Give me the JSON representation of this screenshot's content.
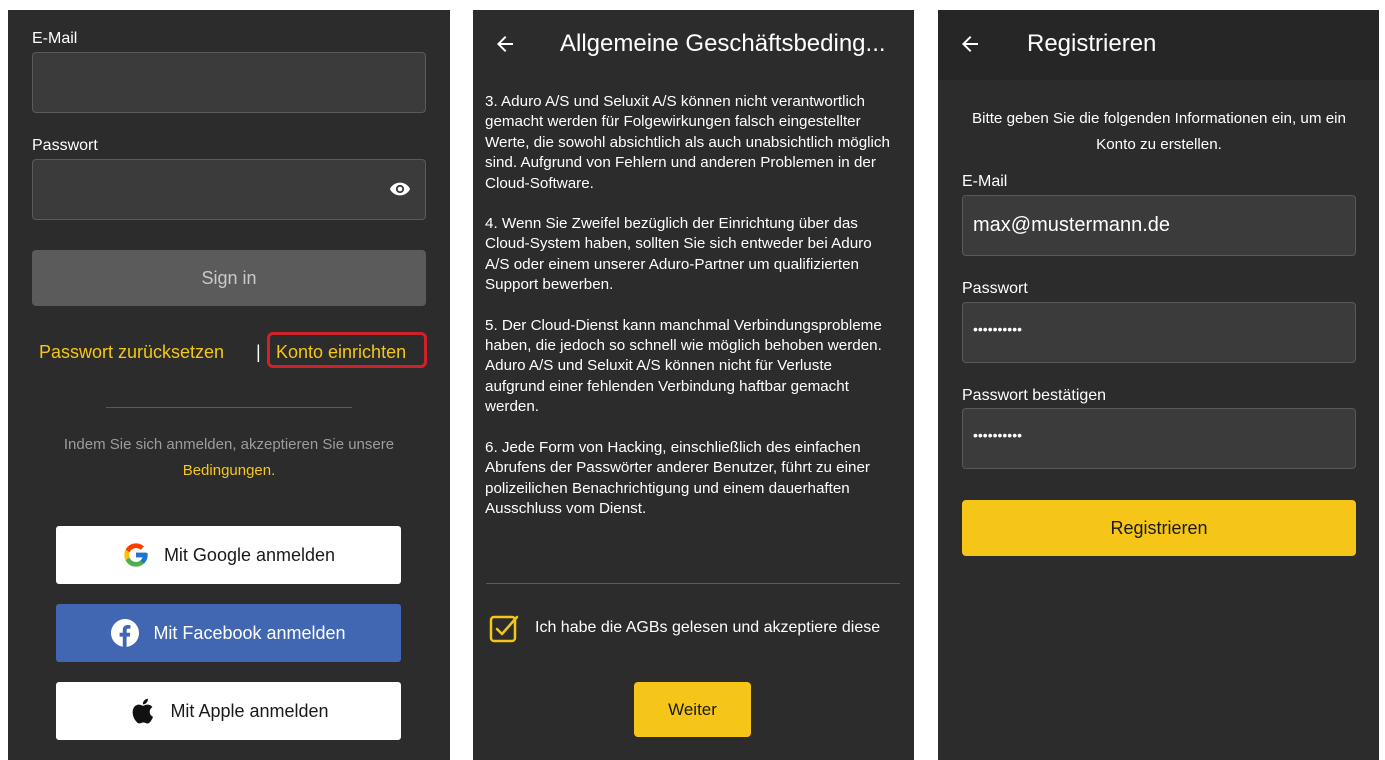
{
  "login": {
    "email_label": "E-Mail",
    "email_value": "",
    "password_label": "Passwort",
    "password_value": "",
    "signin_label": "Sign in",
    "reset_password": "Passwort zurücksetzen",
    "separator": "|",
    "create_account": "Konto einrichten",
    "terms_prefix": "Indem Sie sich anmelden, akzeptieren Sie unsere",
    "terms_link": "Bedingungen.",
    "google": "Mit Google anmelden",
    "facebook": "Mit Facebook anmelden",
    "apple": "Mit Apple anmelden",
    "highlight_color": "#d0202a",
    "accent": "#f5c518",
    "facebook_color": "#4267b2"
  },
  "agb": {
    "title": "Allgemeine Geschäftsbeding...",
    "paragraphs": [
      "3. Aduro A/S und Seluxit A/S können nicht verantwortlich gemacht werden für Folgewirkungen falsch eingestellter Werte, die sowohl absichtlich als auch unabsichtlich möglich sind. Aufgrund von Fehlern und anderen Problemen in der Cloud-Software.",
      "4. Wenn Sie Zweifel bezüglich der Einrichtung über das Cloud-System haben, sollten Sie sich entweder bei Aduro A/S oder einem unserer Aduro-Partner um qualifizierten Support bewerben.",
      "5. Der Cloud-Dienst kann manchmal Verbindungsprobleme haben, die jedoch so schnell wie möglich behoben werden. Aduro A/S und Seluxit A/S können nicht für Verluste aufgrund einer fehlenden Verbindung haftbar gemacht werden.",
      "6. Jede Form von Hacking, einschließlich des einfachen Abrufens der Passwörter anderer Benutzer, führt zu einer polizeilichen Benachrichtigung und einem dauerhaften Ausschluss vom Dienst."
    ],
    "accept_label": "Ich habe die AGBs gelesen und akzeptiere diese",
    "accept_checked": true,
    "continue_label": "Weiter"
  },
  "register": {
    "title": "Registrieren",
    "intro": "Bitte geben Sie die folgenden Informationen ein, um ein Konto zu erstellen.",
    "email_label": "E-Mail",
    "email_value": "max@mustermann.de",
    "password_label": "Passwort",
    "password_value": "••••••••••",
    "confirm_label": "Passwort bestätigen",
    "confirm_value": "••••••••••",
    "submit_label": "Registrieren"
  },
  "icons": {
    "eye": "eye-icon",
    "back": "arrow-left-icon",
    "google": "google-icon",
    "facebook": "facebook-icon",
    "apple": "apple-icon",
    "checkbox": "checkbox-checked-icon"
  }
}
